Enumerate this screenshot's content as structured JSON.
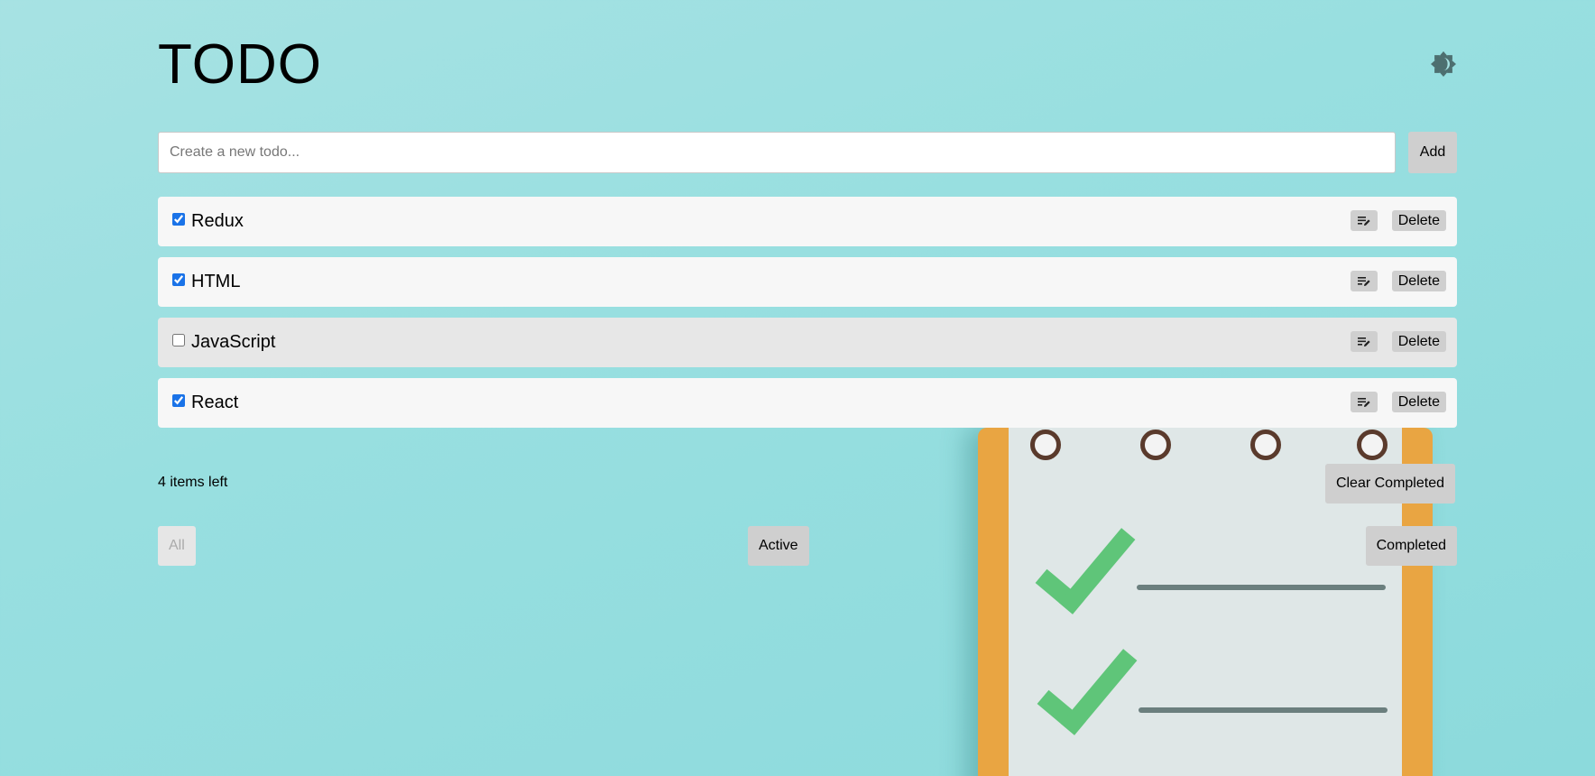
{
  "header": {
    "title": "TODO",
    "theme_icon": "brightness-icon"
  },
  "new_todo": {
    "placeholder": "Create a new todo...",
    "value": "",
    "add_label": "Add"
  },
  "todos": [
    {
      "text": "Redux",
      "completed": true
    },
    {
      "text": "HTML",
      "completed": true
    },
    {
      "text": "JavaScript",
      "completed": false
    },
    {
      "text": "React",
      "completed": true
    }
  ],
  "item_actions": {
    "edit_icon": "edit-icon",
    "delete_label": "Delete"
  },
  "footer": {
    "items_left": "4 items left",
    "clear_label": "Clear Completed"
  },
  "filters": {
    "all": "All",
    "active": "Active",
    "completed": "Completed",
    "selected": "All"
  },
  "colors": {
    "background": "#98dfe0",
    "checkbox_accent": "#1a73e8",
    "button_bg": "#cfcfcf"
  }
}
